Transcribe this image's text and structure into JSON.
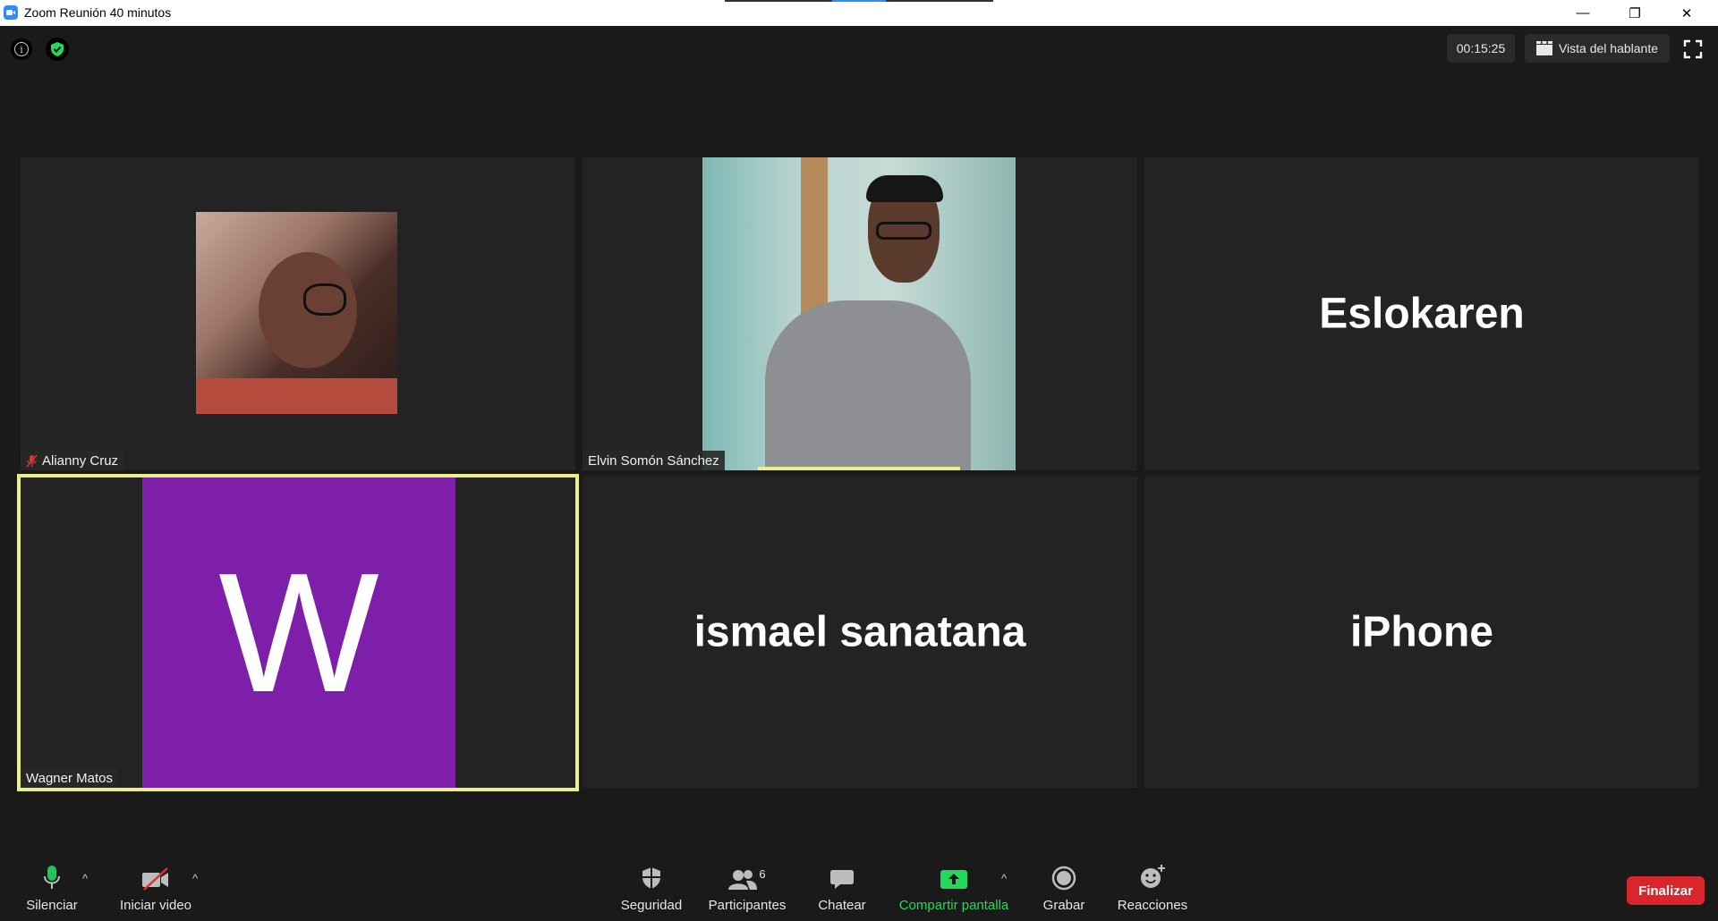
{
  "window": {
    "title": "Zoom Reunión 40 minutos",
    "minimize": "—",
    "restore": "❐",
    "close": "✕"
  },
  "topbar": {
    "info_glyph": "i",
    "timer": "00:15:25",
    "view_label": "Vista del hablante"
  },
  "participants": [
    {
      "name": "Alianny Cruz",
      "muted": true
    },
    {
      "name": "Elvin Somón Sánchez"
    },
    {
      "name": "Eslokaren"
    },
    {
      "name": "Wagner Matos",
      "avatar_letter": "W",
      "avatar_color": "#7e1fa9",
      "active_speaker": true
    },
    {
      "name": "ismael sanatana"
    },
    {
      "name": "iPhone"
    }
  ],
  "toolbar": {
    "mute_label": "Silenciar",
    "video_label": "Iniciar video",
    "security_label": "Seguridad",
    "participants_label": "Participantes",
    "participants_count": "6",
    "chat_label": "Chatear",
    "share_label": "Compartir pantalla",
    "record_label": "Grabar",
    "reactions_label": "Reacciones",
    "end_label": "Finalizar",
    "caret": "^"
  },
  "colors": {
    "share_green": "#23d959",
    "mic_green": "#21c35a",
    "end_red": "#d8262b",
    "active_border": "#e9f08a",
    "zoom_blue": "#2d8cff"
  }
}
